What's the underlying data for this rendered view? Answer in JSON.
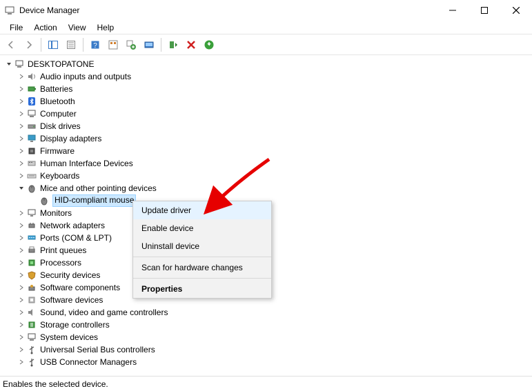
{
  "window": {
    "title": "Device Manager"
  },
  "menubar": [
    "File",
    "Action",
    "View",
    "Help"
  ],
  "tree": {
    "root": "DESKTOPATONE",
    "items": [
      "Audio inputs and outputs",
      "Batteries",
      "Bluetooth",
      "Computer",
      "Disk drives",
      "Display adapters",
      "Firmware",
      "Human Interface Devices",
      "Keyboards"
    ],
    "mice": {
      "label": "Mice and other pointing devices",
      "child": "HID-compliant mouse"
    },
    "rest": [
      "Monitors",
      "Network adapters",
      "Ports (COM & LPT)",
      "Print queues",
      "Processors",
      "Security devices",
      "Software components",
      "Software devices",
      "Sound, video and game controllers",
      "Storage controllers",
      "System devices",
      "Universal Serial Bus controllers",
      "USB Connector Managers"
    ]
  },
  "context_menu": {
    "items": [
      "Update driver",
      "Enable device",
      "Uninstall device",
      "Scan for hardware changes",
      "Properties"
    ]
  },
  "statusbar": "Enables the selected device."
}
